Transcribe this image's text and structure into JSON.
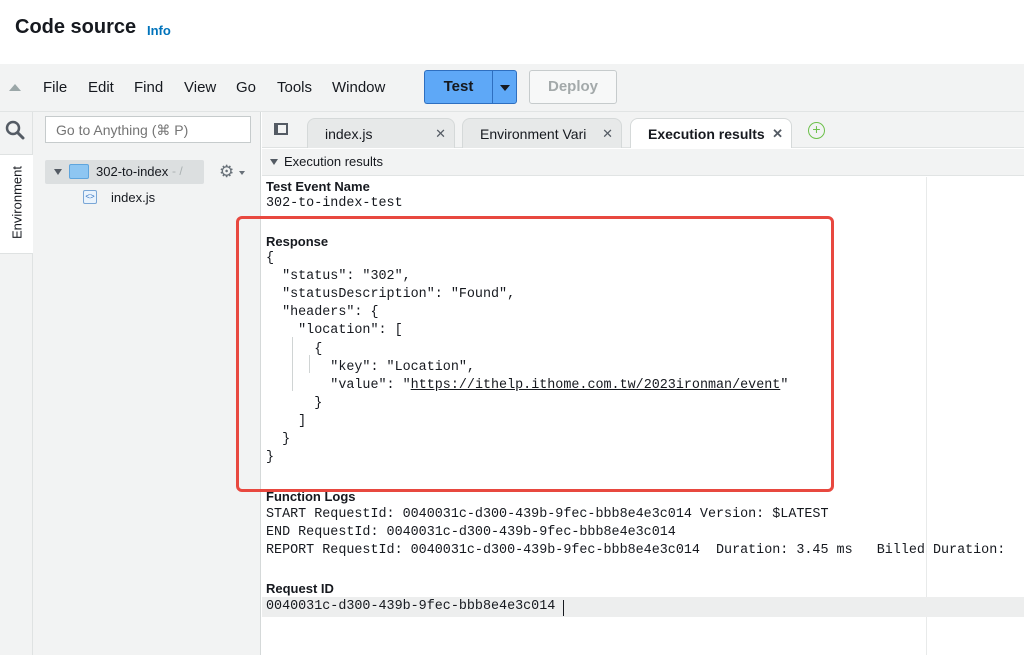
{
  "header": {
    "title": "Code source",
    "info_link": "Info"
  },
  "menubar": {
    "items": [
      "File",
      "Edit",
      "Find",
      "View",
      "Go",
      "Tools",
      "Window"
    ],
    "test_label": "Test",
    "deploy_label": "Deploy"
  },
  "sidebar": {
    "rail_tab": "Environment",
    "search_placeholder": "Go to Anything (⌘ P)",
    "tree": {
      "folder": "302-to-index",
      "folder_suffix": "- /",
      "file": "index.js"
    }
  },
  "tabs": [
    {
      "label": "index.js",
      "active": false
    },
    {
      "label": "Environment Vari",
      "active": false
    },
    {
      "label": "Execution results",
      "active": true
    }
  ],
  "results": {
    "header": "Execution results",
    "test_event_title": "Test Event Name",
    "test_event_value": "302-to-index-test",
    "response_title": "Response",
    "response_lines": [
      "{",
      "  \"status\": \"302\",",
      "  \"statusDescription\": \"Found\",",
      "  \"headers\": {",
      "    \"location\": [",
      "      {",
      "        \"key\": \"Location\",",
      "        \"value\": \"",
      "      }",
      "    ]",
      "  }",
      "}"
    ],
    "response_url": "https://ithelp.ithome.com.tw/2023ironman/event",
    "function_logs_title": "Function Logs",
    "log_lines": [
      "START RequestId: 0040031c-d300-439b-9fec-bbb8e4e3c014 Version: $LATEST",
      "END RequestId: 0040031c-d300-439b-9fec-bbb8e4e3c014",
      "REPORT RequestId: 0040031c-d300-439b-9fec-bbb8e4e3c014  Duration: 3.45 ms   Billed Duration: "
    ],
    "request_id_title": "Request ID",
    "request_id_value": "0040031c-d300-439b-9fec-bbb8e4e3c014"
  },
  "colors": {
    "accent": "#0073bb",
    "test_button": "#5ea8f7",
    "highlight_box": "#e8483f"
  }
}
